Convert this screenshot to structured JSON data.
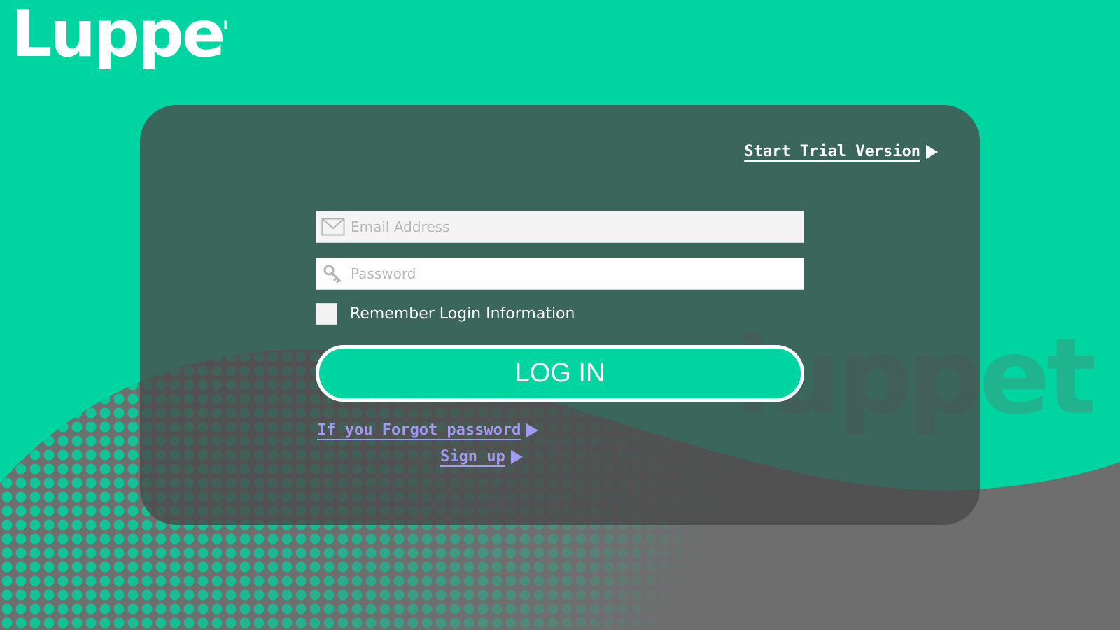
{
  "brand": {
    "name": "Luppet",
    "logo_color": "#ffffff",
    "background_color": "#00d4a0",
    "dark_color": "#4a4a4a",
    "link_color": "#a39af2"
  },
  "header": {
    "trial_label": "Start Trial Version"
  },
  "form": {
    "email_placeholder": "Email Address",
    "password_placeholder": "Password",
    "remember_label": "Remember Login Information",
    "login_label": "LOG IN"
  },
  "links": {
    "forgot_label": "If you Forgot password",
    "signup_label": "Sign up"
  },
  "icons": {
    "email": "envelope-icon",
    "password": "key-icon",
    "arrow": "play-arrow-icon"
  }
}
